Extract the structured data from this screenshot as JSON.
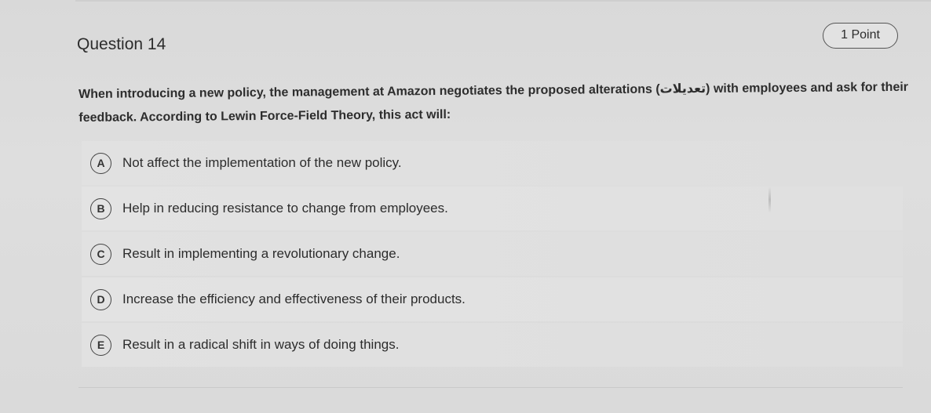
{
  "question": {
    "title": "Question 14",
    "points_label": "1 Point",
    "prompt": "When introducing a new policy, the management at Amazon negotiates the proposed alterations (تعديلات) with employees and ask for their feedback. According to Lewin Force-Field Theory, this act will:"
  },
  "choices": [
    {
      "letter": "A",
      "text": "Not affect the implementation of the new policy."
    },
    {
      "letter": "B",
      "text": "Help in reducing resistance to change from employees."
    },
    {
      "letter": "C",
      "text": "Result in implementing a revolutionary change."
    },
    {
      "letter": "D",
      "text": "Increase the efficiency and effectiveness of their products."
    },
    {
      "letter": "E",
      "text": "Result in a radical shift in ways of doing things."
    }
  ]
}
